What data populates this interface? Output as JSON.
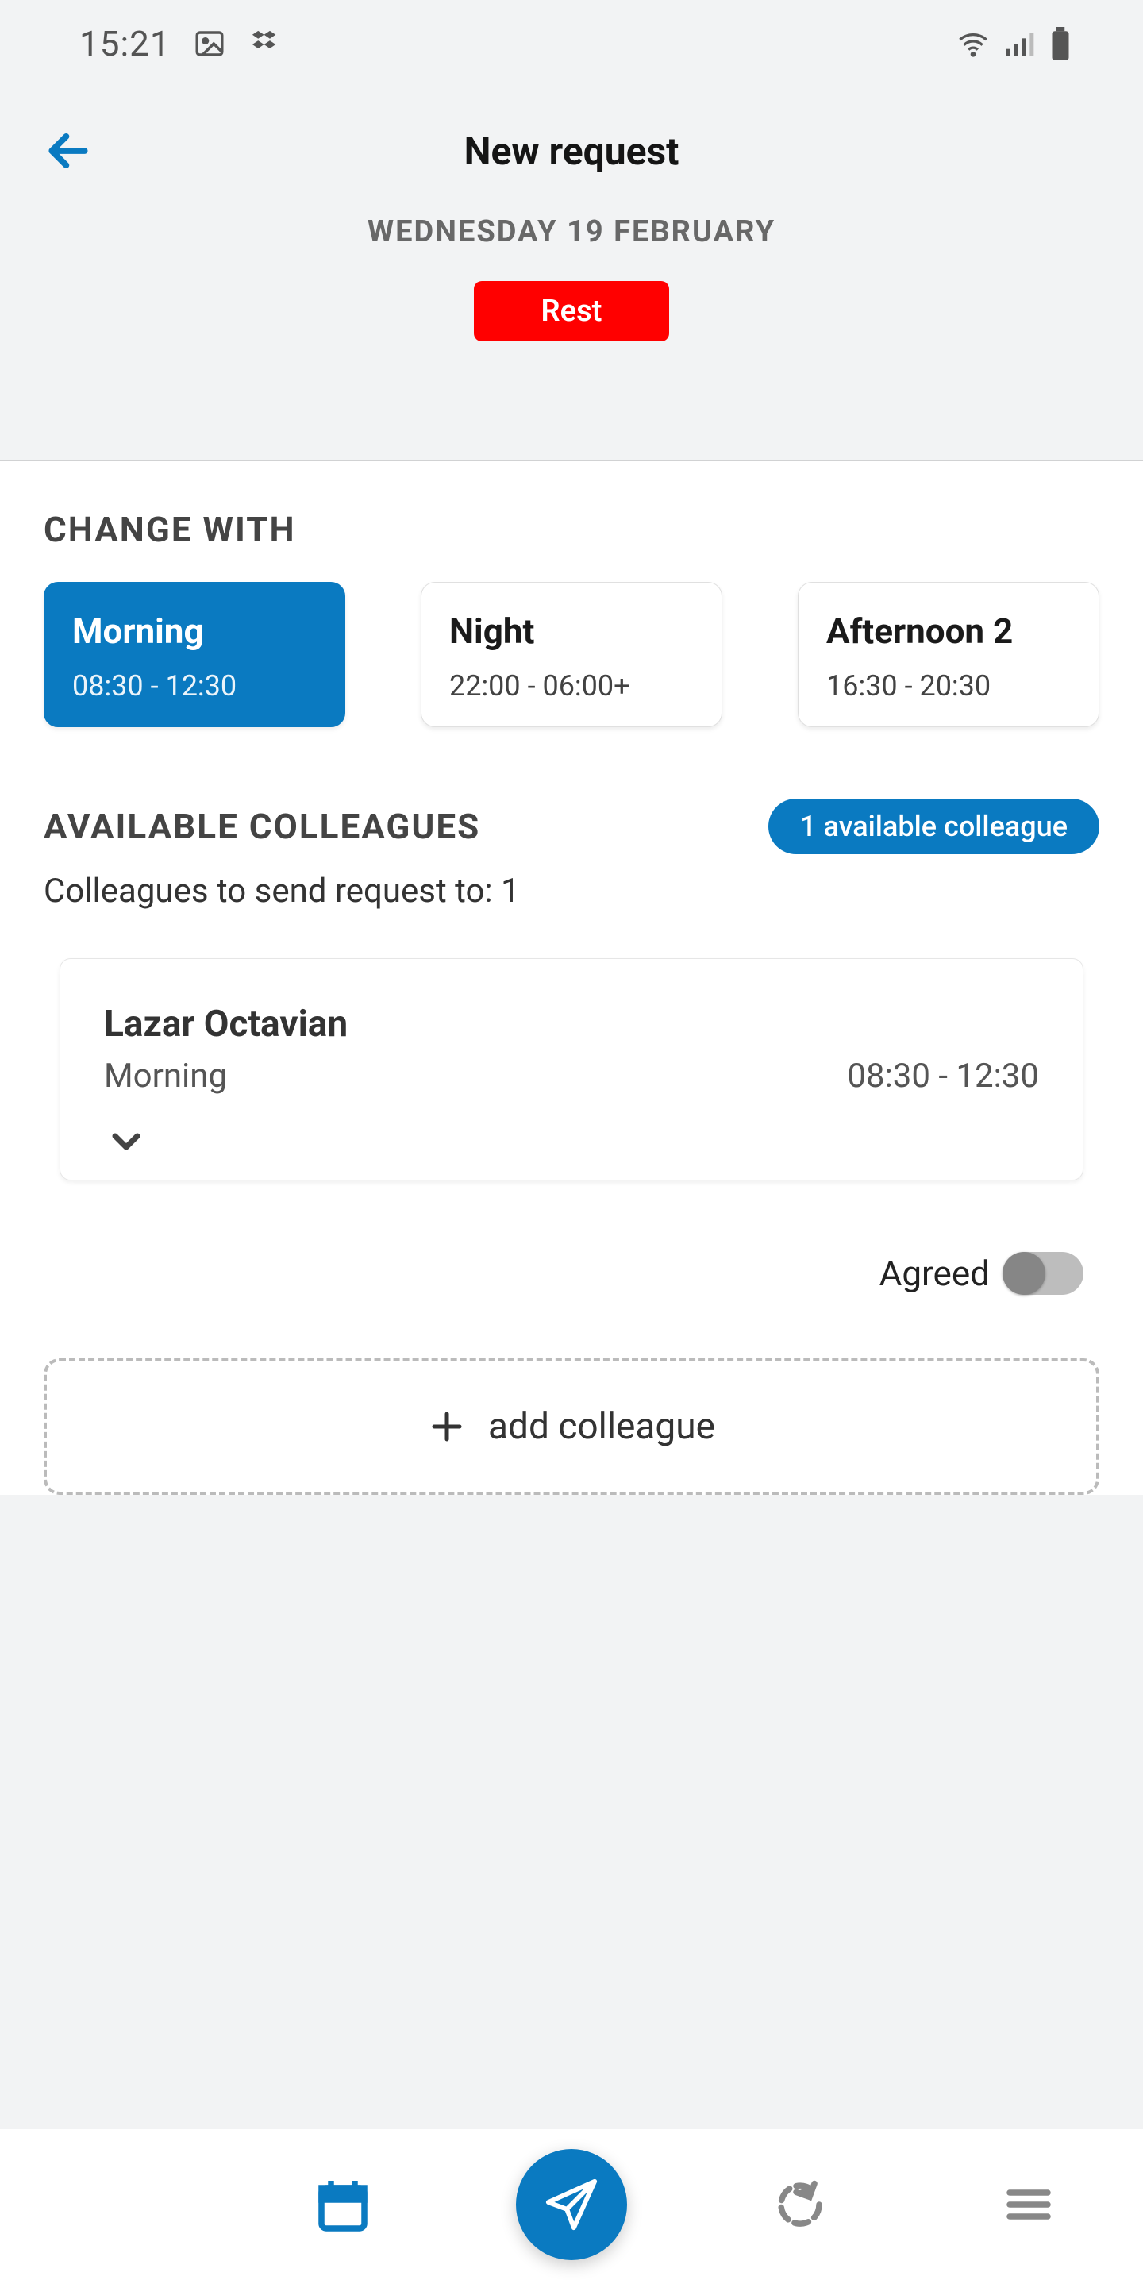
{
  "status": {
    "time": "15:21",
    "left_icons": [
      "image-icon",
      "dropbox-icon"
    ],
    "right_icons": [
      "wifi-icon",
      "signal-icon",
      "battery-icon"
    ]
  },
  "header": {
    "title": "New request",
    "date": "WEDNESDAY 19 FEBRUARY",
    "current_shift_label": "Rest"
  },
  "colors": {
    "accent": "#0a7ac1",
    "danger": "#ff0000"
  },
  "sections": {
    "change_with_label": "CHANGE WITH",
    "shifts": [
      {
        "name": "Morning",
        "time": "08:30 - 12:30",
        "selected": true
      },
      {
        "name": "Night",
        "time": "22:00 - 06:00+",
        "selected": false
      },
      {
        "name": "Afternoon 2",
        "time": "16:30 - 20:30",
        "selected": false
      }
    ],
    "available_label": "AVAILABLE COLLEAGUES",
    "available_pill": "1 available colleague",
    "send_to_text": "Colleagues to send request to: 1",
    "colleague": {
      "name": "Lazar Octavian",
      "shift": "Morning",
      "time": "08:30 - 12:30"
    },
    "agreed_label": "Agreed",
    "agreed_value": false,
    "add_colleague_label": "add colleague"
  }
}
